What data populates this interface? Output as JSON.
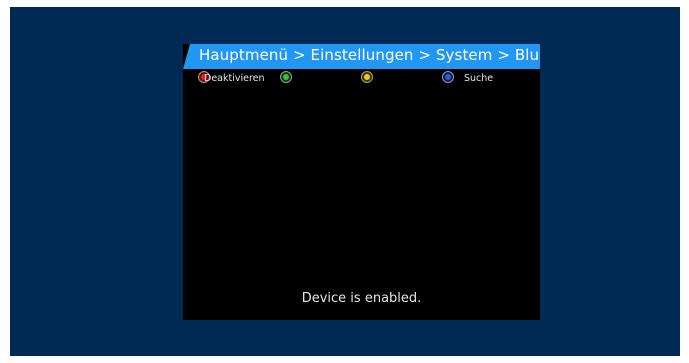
{
  "colors": {
    "screen_background": "#002a54",
    "osd_background": "#000000",
    "title_bar": "#2196f3",
    "key_red": "#e02020",
    "key_green": "#36c436",
    "key_yellow": "#e8cc20",
    "key_blue": "#2f5bd6"
  },
  "header": {
    "title": "Hauptmenü > Einstellungen > System > Bluetooth"
  },
  "color_keys": [
    {
      "color": "red",
      "label": "Deaktivieren",
      "icon": "red-button-icon"
    },
    {
      "color": "green",
      "label": "",
      "icon": "green-button-icon"
    },
    {
      "color": "yellow",
      "label": "",
      "icon": "yellow-button-icon"
    },
    {
      "color": "blue",
      "label": "Suche",
      "icon": "blue-button-icon"
    }
  ],
  "status": {
    "message": "Device is enabled."
  }
}
